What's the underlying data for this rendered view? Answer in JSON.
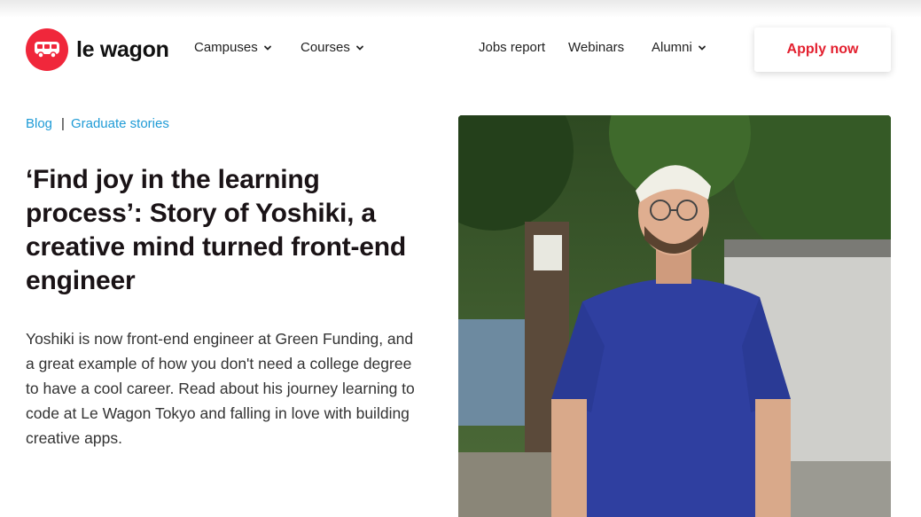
{
  "brand": {
    "name": "le wagon",
    "accent": "#f0273b"
  },
  "nav": {
    "campuses": "Campuses",
    "courses": "Courses",
    "jobs_report": "Jobs report",
    "webinars": "Webinars",
    "alumni": "Alumni",
    "apply": "Apply now"
  },
  "breadcrumb": {
    "blog": "Blog",
    "category": "Graduate stories",
    "link_color": "#1f9bd6"
  },
  "article": {
    "title": "‘Find joy in the learning process’: Story of Yoshiki, a creative mind turned front-end engineer",
    "lead": "Yoshiki is now front-end engineer at Green Funding, and a great example of how you don't need a college degree to have a cool career. Read about his journey learning to code at Le Wagon Tokyo and falling in love with building creative apps."
  },
  "icons": [
    "bus-icon",
    "chevron-down-icon"
  ]
}
